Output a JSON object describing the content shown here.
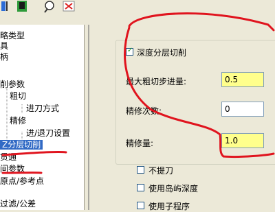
{
  "toolbar": {
    "buttons": [
      {
        "icon": "run-icon"
      },
      {
        "icon": "gauge-icon"
      },
      {
        "icon": "preview-icon"
      },
      {
        "icon": "delete-icon"
      }
    ]
  },
  "tree": {
    "items": [
      {
        "label": "略类型"
      },
      {
        "label": "具"
      },
      {
        "label": "柄"
      },
      {
        "label": "削参数"
      },
      {
        "label": "粗切"
      },
      {
        "label": "进刀方式"
      },
      {
        "label": "精修"
      },
      {
        "label": "进/退刀设置"
      },
      {
        "label": "Z分层切削",
        "selected": true
      },
      {
        "label": "贯通"
      },
      {
        "label": "间参数"
      },
      {
        "label": "原点/参考点"
      },
      {
        "label": "过滤/公差"
      }
    ]
  },
  "depth_cut": {
    "enable_label": "深度分层切削",
    "enabled": true,
    "max_rough_step_label": "最大粗切步进量:",
    "max_rough_step_value": "0.5",
    "finish_passes_label": "精修次数:",
    "finish_passes_value": "0",
    "finish_amount_label": "精修量:",
    "finish_amount_value": "1.0"
  },
  "options": {
    "no_retract_label": "不提刀",
    "use_island_depth_label": "使用岛屿深度",
    "third_label": "使用子程序"
  },
  "colors": {
    "annotation": "#e0141e",
    "highlight_field": "#ffff8c",
    "selection": "#316ac5"
  }
}
